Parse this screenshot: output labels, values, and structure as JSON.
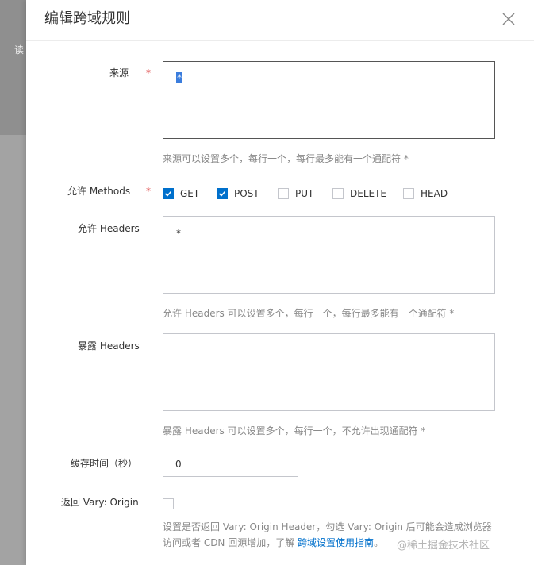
{
  "background": {
    "partial_text": "读"
  },
  "drawer": {
    "title": "编辑跨域规则"
  },
  "form": {
    "origin": {
      "label": "来源",
      "required_mark": "*",
      "value": "*",
      "hint": "来源可以设置多个，每行一个，每行最多能有一个通配符 *"
    },
    "methods": {
      "label": "允许 Methods",
      "required_mark": "*",
      "options": [
        {
          "label": "GET",
          "checked": true
        },
        {
          "label": "POST",
          "checked": true
        },
        {
          "label": "PUT",
          "checked": false
        },
        {
          "label": "DELETE",
          "checked": false
        },
        {
          "label": "HEAD",
          "checked": false
        }
      ]
    },
    "allow_headers": {
      "label": "允许 Headers",
      "value": "*",
      "hint": "允许 Headers 可以设置多个，每行一个，每行最多能有一个通配符 *"
    },
    "expose_headers": {
      "label": "暴露 Headers",
      "value": "",
      "hint": "暴露 Headers 可以设置多个，每行一个，不允许出现通配符 *"
    },
    "cache_time": {
      "label": "缓存时间（秒）",
      "value": "0"
    },
    "vary_origin": {
      "label": "返回 Vary: Origin",
      "checked": false,
      "hint_line1": "设置是否返回 Vary: Origin Header，勾选 Vary: Origin 后可能会造成浏览器",
      "hint_line2_prefix": "访问或者 CDN 回源增加，了解 ",
      "hint_link": "跨域设置使用指南",
      "hint_line2_suffix": "。"
    }
  },
  "watermark": "@稀土掘金技术社区",
  "colors": {
    "accent": "#0070cc",
    "required": "#e05050",
    "hint": "#888888"
  }
}
